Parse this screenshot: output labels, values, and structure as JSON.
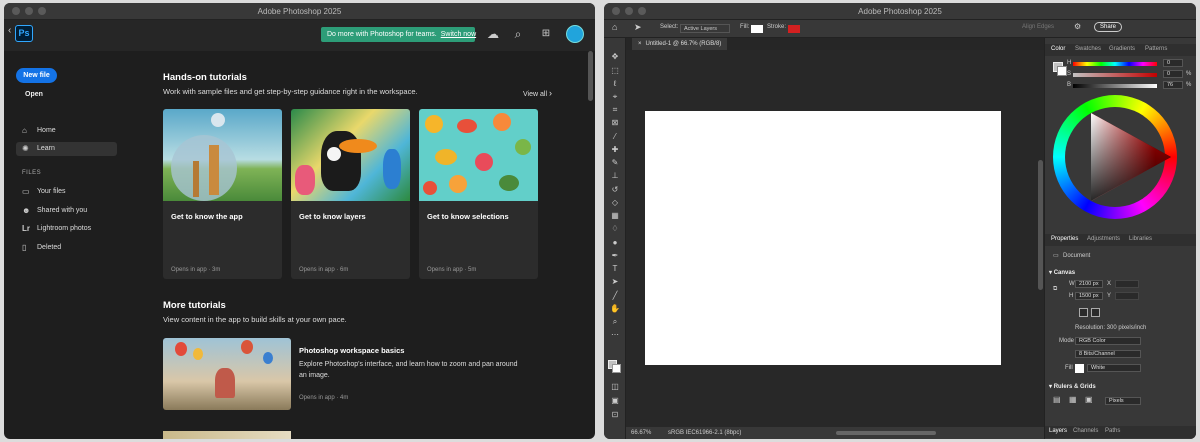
{
  "left": {
    "title": "Adobe Photoshop 2025",
    "app_logo": "Ps",
    "promo_text": "Do more with Photoshop for teams.",
    "promo_link": "Switch now",
    "new_file": "New file",
    "open": "Open",
    "nav": [
      {
        "label": "Home",
        "icon": "home-icon"
      },
      {
        "label": "Learn",
        "icon": "lightbulb-icon"
      }
    ],
    "files_section": "FILES",
    "files": [
      {
        "label": "Your files",
        "icon": "file-icon"
      },
      {
        "label": "Shared with you",
        "icon": "people-icon"
      },
      {
        "label": "Lightroom photos",
        "icon": "lightroom-icon"
      },
      {
        "label": "Deleted",
        "icon": "trash-icon"
      }
    ],
    "hands_on": {
      "title": "Hands-on tutorials",
      "subtitle": "Work with sample files and get step-by-step guidance right in the workspace.",
      "view_all": "View all",
      "cards": [
        {
          "title": "Get to know the app",
          "meta": "Opens in app  ·  3m"
        },
        {
          "title": "Get to know layers",
          "meta": "Opens in app  ·  6m"
        },
        {
          "title": "Get to know selections",
          "meta": "Opens in app  ·  5m"
        }
      ]
    },
    "more": {
      "title": "More tutorials",
      "subtitle": "View content in the app to build skills at your own pace.",
      "item_title": "Photoshop workspace basics",
      "item_desc": "Explore Photoshop's interface, and learn how to zoom and pan around an image.",
      "item_meta": "Opens in app  ·  4m"
    }
  },
  "right": {
    "title": "Adobe Photoshop 2025",
    "options": {
      "select_label": "Select:",
      "select_value": "Active Layers",
      "fill": "Fill:",
      "stroke": "Stroke:",
      "align_edges": "Align Edges",
      "share": "Share"
    },
    "doc_tab": "Untitled-1 @ 66.7% (RGB/8)",
    "status": {
      "zoom": "66.67%",
      "profile": "sRGB IEC61966-2.1 (8bpc)"
    },
    "color_tabs": [
      "Color",
      "Swatches",
      "Gradients",
      "Patterns"
    ],
    "hsb": [
      {
        "k": "H",
        "v": "0"
      },
      {
        "k": "S",
        "v": "0"
      },
      {
        "k": "B",
        "v": "76"
      }
    ],
    "hsb_unit": "%",
    "props_tabs": [
      "Properties",
      "Adjustments",
      "Libraries"
    ],
    "doc_label": "Document",
    "canvas_label": "Canvas",
    "w_label": "W",
    "w_value": "2100 px",
    "h_label": "H",
    "h_value": "1500 px",
    "x_label": "X",
    "y_label": "Y",
    "resolution": "Resolution: 300 pixels/inch",
    "mode_label": "Mode",
    "mode_value": "RGB Color",
    "bits_value": "8 Bits/Channel",
    "fill_label": "Fill",
    "fill_value": "White",
    "rulers": "Rulers & Grids",
    "units": "Pixels",
    "layers_tabs": [
      "Layers",
      "Channels",
      "Paths"
    ]
  }
}
